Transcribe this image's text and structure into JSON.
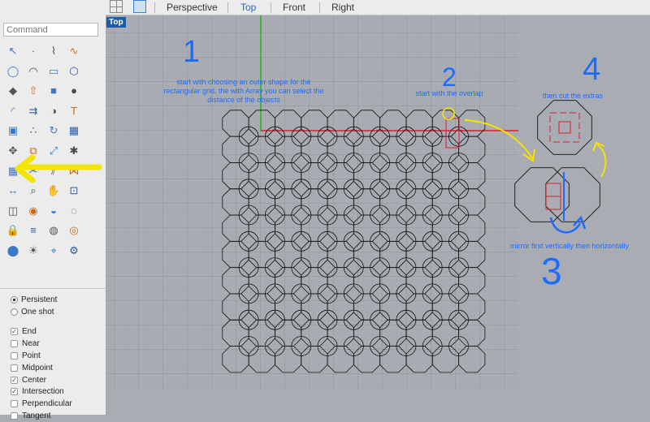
{
  "command": {
    "placeholder": "Command"
  },
  "view_tabs": [
    {
      "label": "Perspective",
      "active": false
    },
    {
      "label": "Top",
      "active": true
    },
    {
      "label": "Front",
      "active": false
    },
    {
      "label": "Right",
      "active": false
    }
  ],
  "viewport_label": "Top",
  "osnap": {
    "mode": [
      {
        "label": "Persistent",
        "selected": true
      },
      {
        "label": "One shot",
        "selected": false
      }
    ],
    "items": [
      {
        "label": "End",
        "checked": true
      },
      {
        "label": "Near",
        "checked": false
      },
      {
        "label": "Point",
        "checked": false
      },
      {
        "label": "Midpoint",
        "checked": false
      },
      {
        "label": "Center",
        "checked": true
      },
      {
        "label": "Intersection",
        "checked": true
      },
      {
        "label": "Perpendicular",
        "checked": false
      },
      {
        "label": "Tangent",
        "checked": false
      }
    ]
  },
  "annotations": {
    "step1_number": "1",
    "step1_text": "start with choosing an outer shape for the rectangular grid, the with Array you can select the distance of the objects",
    "step2_number": "2",
    "step2_text": "start with the overlap",
    "step3_number": "3",
    "step3_text": "mirror first vertically then horizontally",
    "step4_number": "4",
    "step4_text": "then cut the extras"
  },
  "colors": {
    "annotation_blue": "#1e6bff",
    "arrow_yellow": "#f5e400",
    "axis_red": "#d8202a",
    "axis_green": "#1bb81b",
    "viewport_bg": "#a9adb3"
  }
}
